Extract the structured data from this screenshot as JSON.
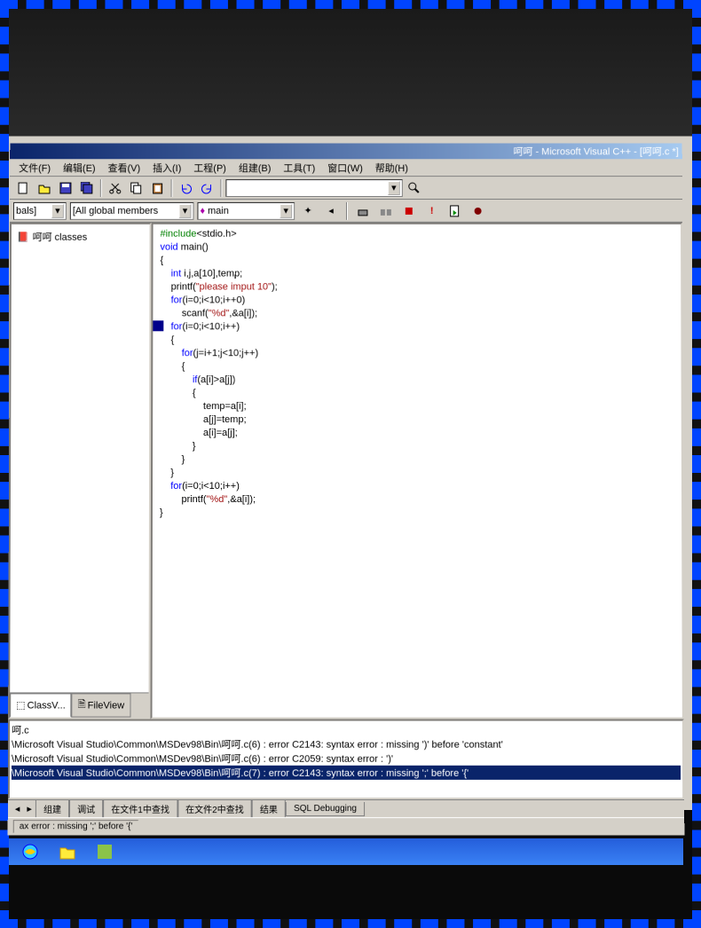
{
  "title": "呵呵 - Microsoft Visual C++ - [呵呵.c *]",
  "menus": {
    "file": "文件(F)",
    "edit": "编辑(E)",
    "view": "查看(V)",
    "insert": "插入(I)",
    "project": "工程(P)",
    "build": "组建(B)",
    "tools": "工具(T)",
    "window": "窗口(W)",
    "help": "帮助(H)"
  },
  "wizard": {
    "globals": "bals]",
    "members": "[All global members",
    "function": "main"
  },
  "tree": {
    "root": "呵呵 classes"
  },
  "side_tabs": {
    "class": "ClassV...",
    "file": "FileView"
  },
  "code_lines": [
    {
      "indent": 0,
      "seg": [
        {
          "t": "#include",
          "c": "pp"
        },
        {
          "t": "<stdio.h>",
          "c": ""
        }
      ]
    },
    {
      "indent": 0,
      "seg": [
        {
          "t": "void",
          "c": "kw"
        },
        {
          "t": " main()",
          "c": ""
        }
      ]
    },
    {
      "indent": 0,
      "seg": [
        {
          "t": "{",
          "c": ""
        }
      ]
    },
    {
      "indent": 1,
      "seg": [
        {
          "t": "int",
          "c": "kw"
        },
        {
          "t": " i,j,a[10],temp;",
          "c": ""
        }
      ]
    },
    {
      "indent": 1,
      "seg": [
        {
          "t": "printf(",
          "c": ""
        },
        {
          "t": "\"please imput 10\"",
          "c": "str"
        },
        {
          "t": ");",
          "c": ""
        }
      ]
    },
    {
      "indent": 1,
      "seg": [
        {
          "t": "for",
          "c": "kw"
        },
        {
          "t": "(i=0;i<10;i++0)",
          "c": ""
        }
      ]
    },
    {
      "indent": 2,
      "seg": [
        {
          "t": "scanf(",
          "c": ""
        },
        {
          "t": "\"%d\"",
          "c": "str"
        },
        {
          "t": ",&a[i]);",
          "c": ""
        }
      ]
    },
    {
      "indent": 1,
      "seg": [
        {
          "t": "for",
          "c": "kw"
        },
        {
          "t": "(i=0;i<10;i++)",
          "c": ""
        }
      ]
    },
    {
      "indent": 1,
      "seg": [
        {
          "t": "{",
          "c": ""
        }
      ]
    },
    {
      "indent": 2,
      "seg": [
        {
          "t": "for",
          "c": "kw"
        },
        {
          "t": "(j=i+1;j<10;j++)",
          "c": ""
        }
      ]
    },
    {
      "indent": 2,
      "seg": [
        {
          "t": "{",
          "c": ""
        }
      ]
    },
    {
      "indent": 3,
      "seg": [
        {
          "t": "if",
          "c": "kw"
        },
        {
          "t": "(a[i]>a[j])",
          "c": ""
        }
      ]
    },
    {
      "indent": 3,
      "seg": [
        {
          "t": "{",
          "c": ""
        }
      ]
    },
    {
      "indent": 4,
      "seg": [
        {
          "t": "temp=a[i];",
          "c": ""
        }
      ]
    },
    {
      "indent": 4,
      "seg": [
        {
          "t": "a[j]=temp;",
          "c": ""
        }
      ]
    },
    {
      "indent": 4,
      "seg": [
        {
          "t": "a[i]=a[j];",
          "c": ""
        }
      ]
    },
    {
      "indent": 3,
      "seg": [
        {
          "t": "}",
          "c": ""
        }
      ]
    },
    {
      "indent": 2,
      "seg": [
        {
          "t": "}",
          "c": ""
        }
      ]
    },
    {
      "indent": 1,
      "seg": [
        {
          "t": "}",
          "c": ""
        }
      ]
    },
    {
      "indent": 1,
      "seg": [
        {
          "t": "for",
          "c": "kw"
        },
        {
          "t": "(i=0;i<10;i++)",
          "c": ""
        }
      ]
    },
    {
      "indent": 2,
      "seg": [
        {
          "t": "printf(",
          "c": ""
        },
        {
          "t": "\"%d\"",
          "c": "str"
        },
        {
          "t": ",&a[i]);",
          "c": ""
        }
      ]
    },
    {
      "indent": 0,
      "seg": [
        {
          "t": "}",
          "c": ""
        }
      ]
    }
  ],
  "output": {
    "lines": [
      "呵.c",
      "\\Microsoft Visual Studio\\Common\\MSDev98\\Bin\\呵呵.c(6) : error C2143: syntax error : missing ')' before 'constant'",
      "\\Microsoft Visual Studio\\Common\\MSDev98\\Bin\\呵呵.c(6) : error C2059: syntax error : ')'",
      "\\Microsoft Visual Studio\\Common\\MSDev98\\Bin\\呵呵.c(7) : error C2143: syntax error : missing ';' before '{'"
    ],
    "selected_index": 3
  },
  "out_tabs": {
    "build": "组建",
    "debug": "调试",
    "find1": "在文件1中查找",
    "find2": "在文件2中查找",
    "results": "结果",
    "sql": "SQL Debugging"
  },
  "status": {
    "text": "ax error : missing ';' before '{'"
  }
}
